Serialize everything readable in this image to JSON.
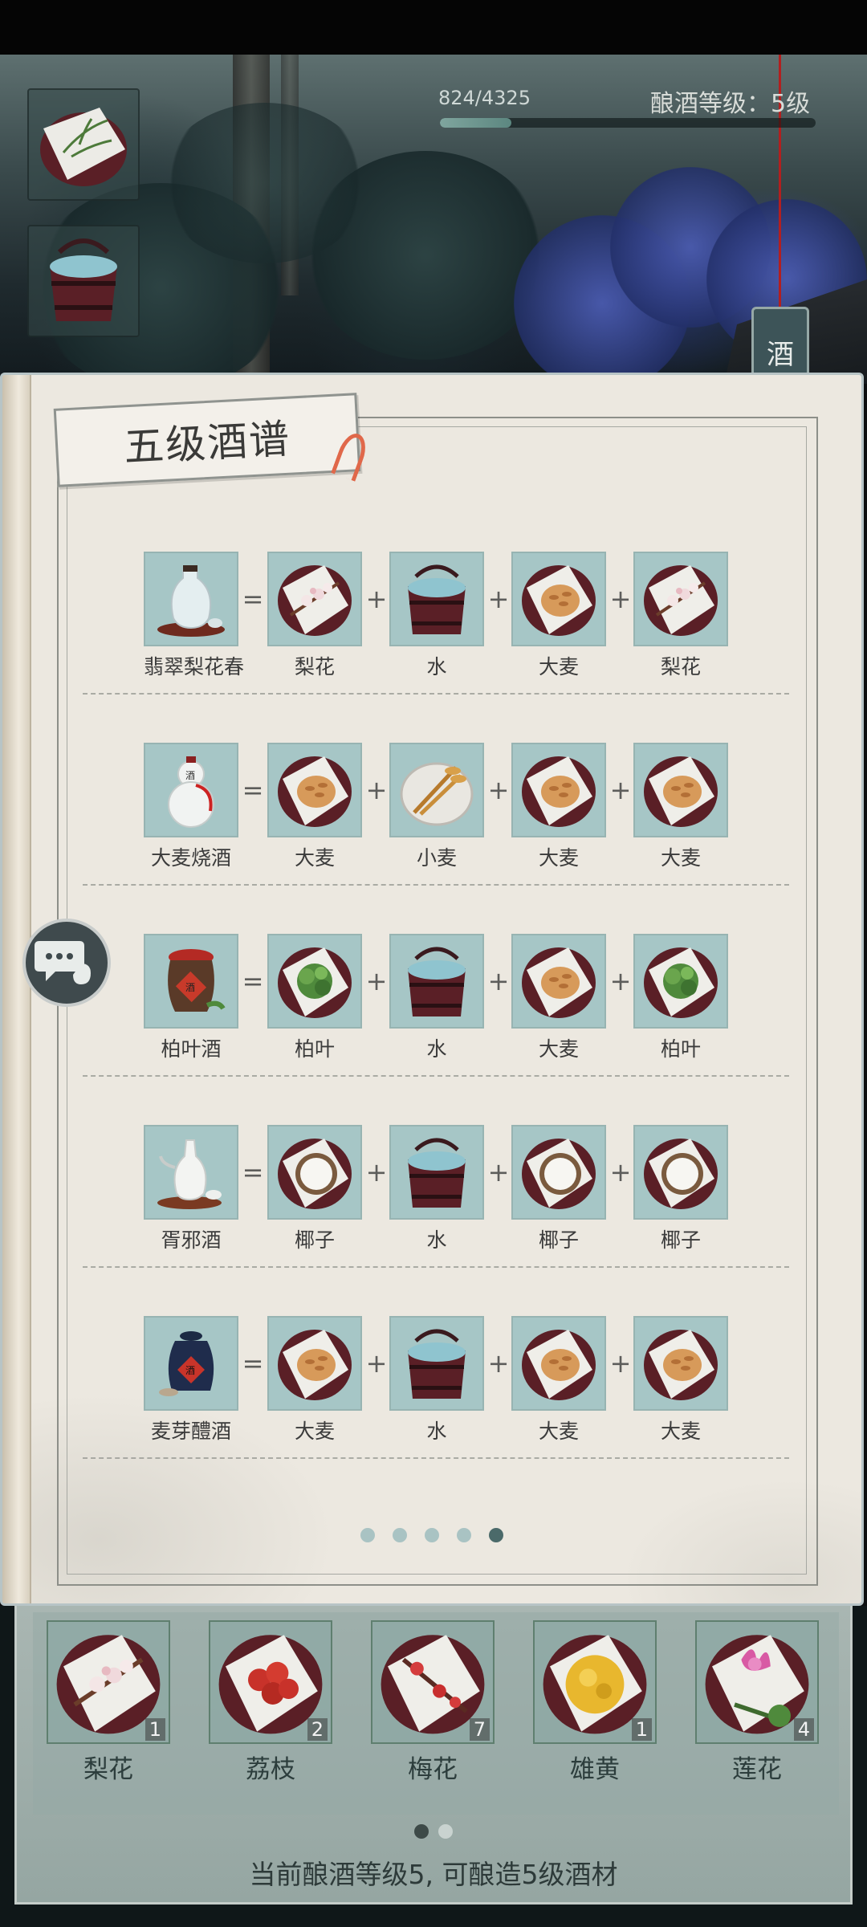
{
  "hud": {
    "exp_text": "824/4325",
    "exp_current": 824,
    "exp_max": 4325,
    "brew_level_text": "酿酒等级：5级",
    "wine_tag": "酒"
  },
  "side_slots": [
    {
      "icon": "herb-plate-icon"
    },
    {
      "icon": "water-bucket-icon"
    }
  ],
  "book": {
    "title": "五级酒谱",
    "recipes": [
      {
        "product": "翡翠梨花春",
        "product_icon": "white-jar-icon",
        "ingredients": [
          "梨花",
          "水",
          "大麦",
          "梨花"
        ]
      },
      {
        "product": "大麦烧酒",
        "product_icon": "gourd-bottle-icon",
        "ingredients": [
          "大麦",
          "小麦",
          "大麦",
          "大麦"
        ]
      },
      {
        "product": "柏叶酒",
        "product_icon": "red-wine-jar-icon",
        "ingredients": [
          "柏叶",
          "水",
          "大麦",
          "柏叶"
        ]
      },
      {
        "product": "胥邪酒",
        "product_icon": "porcelain-ewer-icon",
        "ingredients": [
          "椰子",
          "水",
          "椰子",
          "椰子"
        ]
      },
      {
        "product": "麦芽醴酒",
        "product_icon": "dark-wine-jar-icon",
        "ingredients": [
          "大麦",
          "水",
          "大麦",
          "大麦"
        ]
      }
    ],
    "symbols": {
      "equals": "=",
      "plus": "+"
    },
    "page_count": 5,
    "active_page": 5
  },
  "inventory": {
    "items": [
      {
        "name": "梨花",
        "count": "1"
      },
      {
        "name": "荔枝",
        "count": "2"
      },
      {
        "name": "梅花",
        "count": "7"
      },
      {
        "name": "雄黄",
        "count": "1"
      },
      {
        "name": "莲花",
        "count": "4"
      }
    ],
    "page_count": 2,
    "active_page": 1,
    "hint": "当前酿酒等级5, 可酿造5级酒材"
  },
  "colors": {
    "icon_bg": "#a6c6c6",
    "plate_rim": "#5a1f26",
    "accent_teal": "#4b6a6a"
  }
}
